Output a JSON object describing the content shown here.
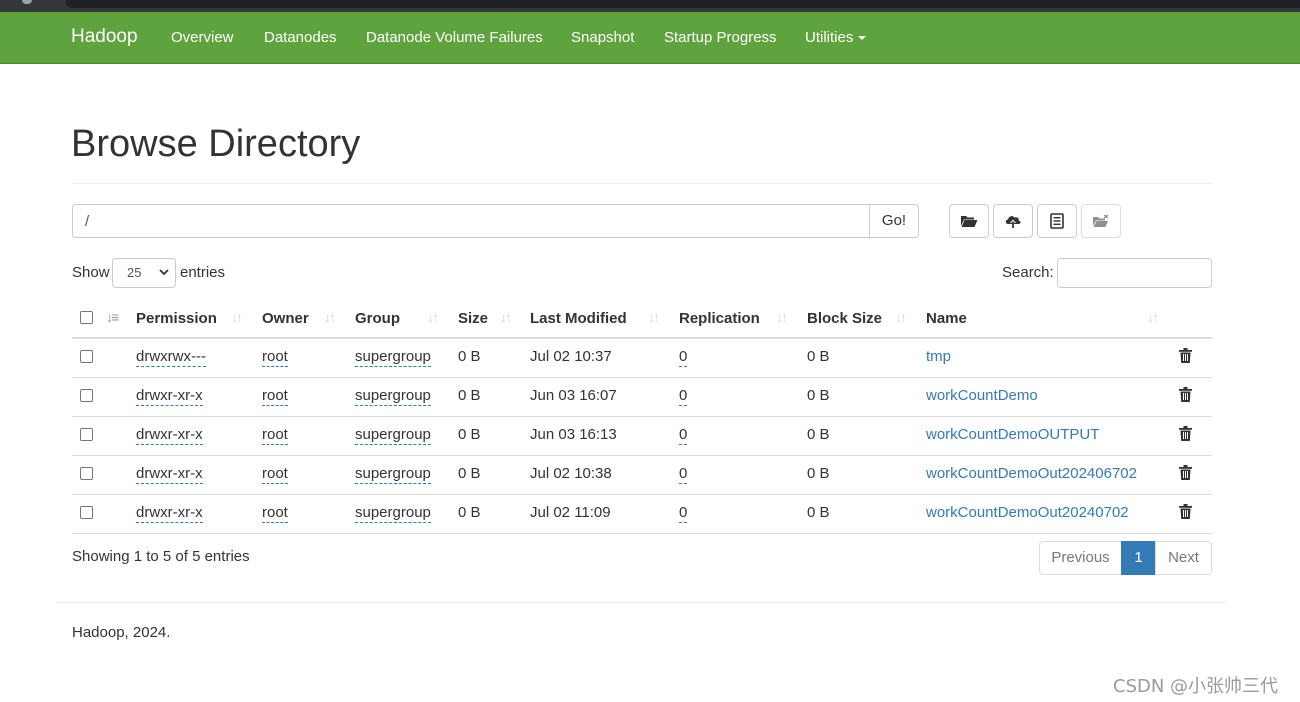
{
  "navbar": {
    "brand": "Hadoop",
    "items": [
      "Overview",
      "Datanodes",
      "Datanode Volume Failures",
      "Snapshot",
      "Startup Progress",
      "Utilities"
    ],
    "color": "#5fa33e"
  },
  "page": {
    "title": "Browse Directory"
  },
  "path_bar": {
    "value": "/",
    "go_label": "Go!"
  },
  "toolbar": {
    "icons": [
      "folder-open-icon",
      "cloud-upload-icon",
      "list-alt-icon",
      "cut-paste-icon"
    ]
  },
  "controls": {
    "show_label": "Show",
    "page_length": "25",
    "entries_label": "entries",
    "search_label": "Search:",
    "search_value": ""
  },
  "table": {
    "columns": [
      "Permission",
      "Owner",
      "Group",
      "Size",
      "Last Modified",
      "Replication",
      "Block Size",
      "Name"
    ],
    "rows": [
      {
        "permission": "drwxrwx---",
        "owner": "root",
        "group": "supergroup",
        "size": "0 B",
        "modified": "Jul 02 10:37",
        "replication": "0",
        "block_size": "0 B",
        "name": "tmp"
      },
      {
        "permission": "drwxr-xr-x",
        "owner": "root",
        "group": "supergroup",
        "size": "0 B",
        "modified": "Jun 03 16:07",
        "replication": "0",
        "block_size": "0 B",
        "name": "workCountDemo"
      },
      {
        "permission": "drwxr-xr-x",
        "owner": "root",
        "group": "supergroup",
        "size": "0 B",
        "modified": "Jun 03 16:13",
        "replication": "0",
        "block_size": "0 B",
        "name": "workCountDemoOUTPUT"
      },
      {
        "permission": "drwxr-xr-x",
        "owner": "root",
        "group": "supergroup",
        "size": "0 B",
        "modified": "Jul 02 10:38",
        "replication": "0",
        "block_size": "0 B",
        "name": "workCountDemoOut202406702"
      },
      {
        "permission": "drwxr-xr-x",
        "owner": "root",
        "group": "supergroup",
        "size": "0 B",
        "modified": "Jul 02 11:09",
        "replication": "0",
        "block_size": "0 B",
        "name": "workCountDemoOut20240702"
      }
    ]
  },
  "pagination": {
    "info": "Showing 1 to 5 of 5 entries",
    "previous": "Previous",
    "current": "1",
    "next": "Next",
    "active_color": "#337ab7"
  },
  "footer": {
    "text": "Hadoop, 2024."
  },
  "watermark": {
    "text": "CSDN @小张帅三代"
  }
}
